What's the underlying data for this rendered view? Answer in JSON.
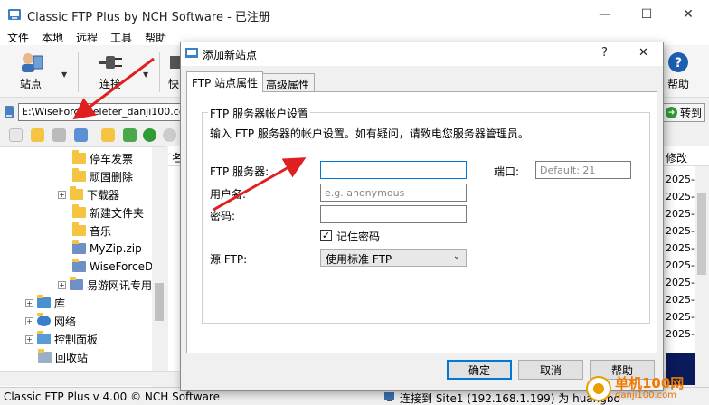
{
  "window": {
    "title": "Classic FTP Plus by NCH Software - 已注册",
    "minimize": "—",
    "maximize": "☐",
    "close": "✕"
  },
  "menu": [
    "文件",
    "本地",
    "远程",
    "工具",
    "帮助"
  ],
  "toolbar": {
    "site": "站点",
    "connect": "连接",
    "quick_partial": "快",
    "help": "帮助"
  },
  "address": {
    "value": "E:\\WiseForceDeleter_danji100.com...",
    "go_label": "转到"
  },
  "tree": [
    {
      "label": "停车发票",
      "icon": "folder"
    },
    {
      "label": "顽固删除",
      "icon": "folder"
    },
    {
      "label": "下载器",
      "icon": "folder",
      "expandable": true
    },
    {
      "label": "新建文件夹",
      "icon": "folder"
    },
    {
      "label": "音乐",
      "icon": "folder"
    },
    {
      "label": "MyZip.zip",
      "icon": "zip"
    },
    {
      "label": "WiseForceD",
      "icon": "zip"
    },
    {
      "label": "易游网讯专用",
      "icon": "zip",
      "expandable": true
    },
    {
      "label": "库",
      "icon": "library",
      "expandable": true
    },
    {
      "label": "网络",
      "icon": "network",
      "expandable": true
    },
    {
      "label": "控制面板",
      "icon": "control-panel",
      "expandable": true
    },
    {
      "label": "回收站",
      "icon": "recycle-bin"
    }
  ],
  "list": {
    "name_header_partial": "名",
    "modified_header": "修改",
    "dates": [
      "2025-",
      "2025-",
      "2025-",
      "2025-",
      "2025-",
      "2025-",
      "2025-",
      "2025-",
      "2025-",
      "2025-"
    ]
  },
  "status": {
    "left": "Classic FTP Plus v 4.00 © NCH Software",
    "right": "连接到 Site1 (192.168.1.199) 为 huangbo"
  },
  "dialog": {
    "title": "添加新站点",
    "help_mark": "?",
    "close": "✕",
    "tabs": [
      {
        "label": "FTP 站点属性",
        "active": true
      },
      {
        "label": "高级属性",
        "active": false
      }
    ],
    "group_title": "FTP 服务器帐户设置",
    "intro": "输入 FTP 服务器的帐户设置。如有疑问，请致电您服务器管理员。",
    "server_label": "FTP 服务器:",
    "server_value": "",
    "port_label": "端口:",
    "port_placeholder": "Default: 21",
    "user_label": "用户名:",
    "user_placeholder": "e.g. anonymous",
    "password_label": "密码:",
    "remember_label": "记住密码",
    "remember_checked": true,
    "source_label": "源 FTP:",
    "source_value": "使用标准 FTP",
    "ok": "确定",
    "cancel": "取消",
    "help": "帮助"
  },
  "watermark": {
    "main": "单机100网",
    "sub": "danji100.com"
  },
  "colors": {
    "arrow": "#e02020",
    "focus": "#0078d7",
    "folder": "#f5c542"
  }
}
